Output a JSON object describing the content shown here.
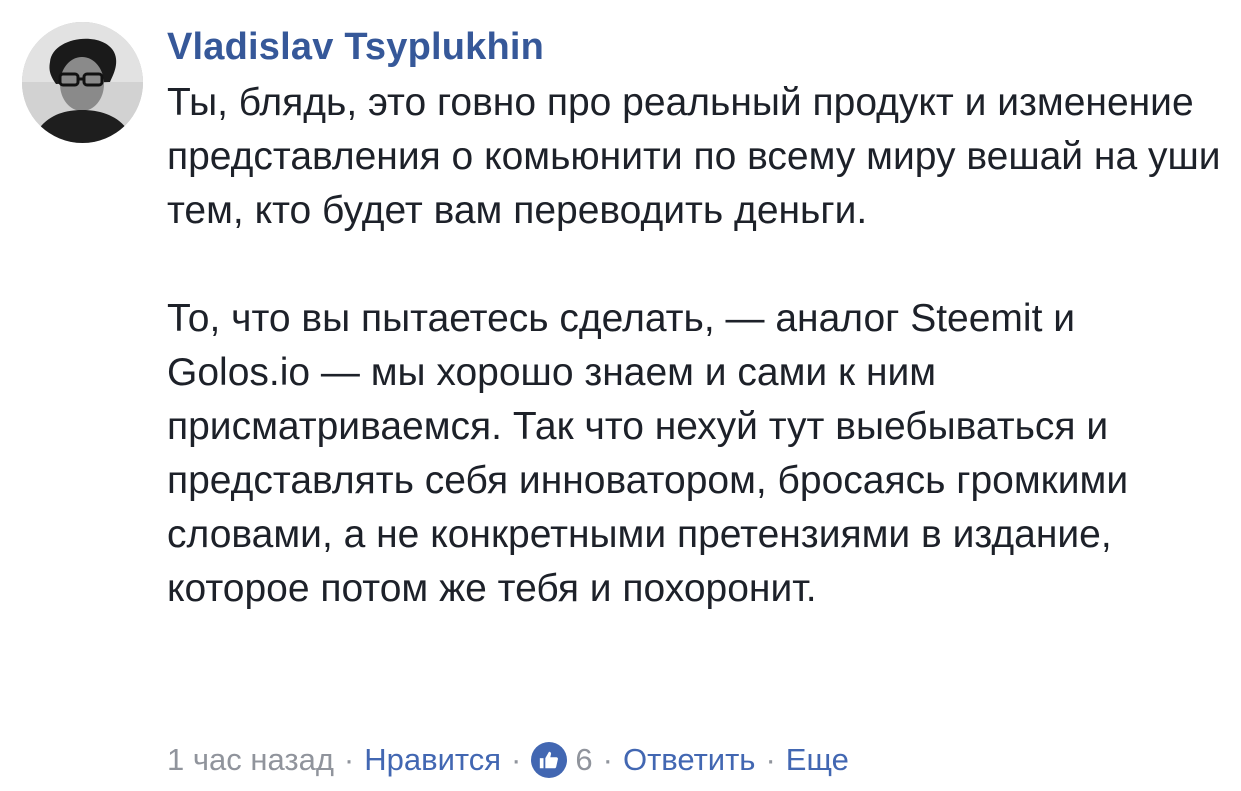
{
  "comment": {
    "author": "Vladislav Tsyplukhin",
    "paragraphs": [
      "Ты, блядь, это говно про реальный продукт и изменение представления о комьюнити по всему миру вешай на уши тем, кто будет вам переводить деньги.",
      "То, что вы пытаетесь сделать, — аналог Steemit и Golos.io — мы хорошо знаем и сами к ним присматриваемся. Так что нехуй тут выебываться и представлять себя инноватором, бросаясь громкими словами, а не конкретными претензиями в издание, которое потом же тебя и похоронит."
    ],
    "footer": {
      "time": "1 час назад",
      "like_label": "Нравится",
      "like_count": "6",
      "reply_label": "Ответить",
      "more_label": "Еще",
      "separator": "·"
    },
    "icons": {
      "avatar": "user-avatar",
      "like": "thumbs-up-icon"
    },
    "colors": {
      "author": "#365899",
      "link": "#4267b2",
      "meta": "#90949c",
      "text": "#1d2129"
    }
  }
}
